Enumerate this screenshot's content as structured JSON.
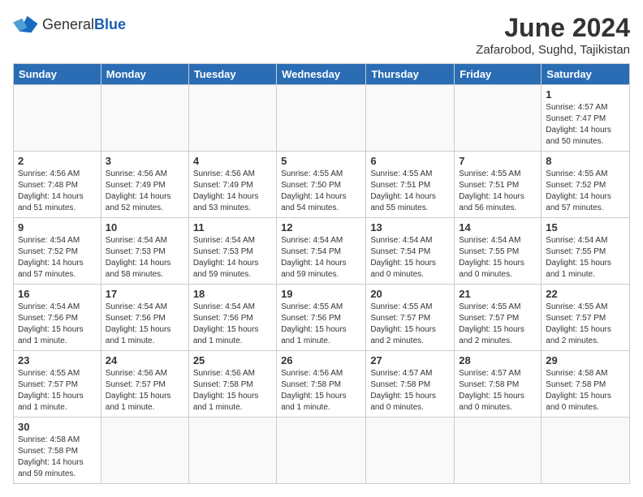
{
  "header": {
    "logo_general": "General",
    "logo_blue": "Blue",
    "title": "June 2024",
    "subtitle": "Zafarobod, Sughd, Tajikistan"
  },
  "days_of_week": [
    "Sunday",
    "Monday",
    "Tuesday",
    "Wednesday",
    "Thursday",
    "Friday",
    "Saturday"
  ],
  "weeks": [
    [
      {
        "day": "",
        "info": ""
      },
      {
        "day": "",
        "info": ""
      },
      {
        "day": "",
        "info": ""
      },
      {
        "day": "",
        "info": ""
      },
      {
        "day": "",
        "info": ""
      },
      {
        "day": "",
        "info": ""
      },
      {
        "day": "1",
        "info": "Sunrise: 4:57 AM\nSunset: 7:47 PM\nDaylight: 14 hours and 50 minutes."
      }
    ],
    [
      {
        "day": "2",
        "info": "Sunrise: 4:56 AM\nSunset: 7:48 PM\nDaylight: 14 hours and 51 minutes."
      },
      {
        "day": "3",
        "info": "Sunrise: 4:56 AM\nSunset: 7:49 PM\nDaylight: 14 hours and 52 minutes."
      },
      {
        "day": "4",
        "info": "Sunrise: 4:56 AM\nSunset: 7:49 PM\nDaylight: 14 hours and 53 minutes."
      },
      {
        "day": "5",
        "info": "Sunrise: 4:55 AM\nSunset: 7:50 PM\nDaylight: 14 hours and 54 minutes."
      },
      {
        "day": "6",
        "info": "Sunrise: 4:55 AM\nSunset: 7:51 PM\nDaylight: 14 hours and 55 minutes."
      },
      {
        "day": "7",
        "info": "Sunrise: 4:55 AM\nSunset: 7:51 PM\nDaylight: 14 hours and 56 minutes."
      },
      {
        "day": "8",
        "info": "Sunrise: 4:55 AM\nSunset: 7:52 PM\nDaylight: 14 hours and 57 minutes."
      }
    ],
    [
      {
        "day": "9",
        "info": "Sunrise: 4:54 AM\nSunset: 7:52 PM\nDaylight: 14 hours and 57 minutes."
      },
      {
        "day": "10",
        "info": "Sunrise: 4:54 AM\nSunset: 7:53 PM\nDaylight: 14 hours and 58 minutes."
      },
      {
        "day": "11",
        "info": "Sunrise: 4:54 AM\nSunset: 7:53 PM\nDaylight: 14 hours and 59 minutes."
      },
      {
        "day": "12",
        "info": "Sunrise: 4:54 AM\nSunset: 7:54 PM\nDaylight: 14 hours and 59 minutes."
      },
      {
        "day": "13",
        "info": "Sunrise: 4:54 AM\nSunset: 7:54 PM\nDaylight: 15 hours and 0 minutes."
      },
      {
        "day": "14",
        "info": "Sunrise: 4:54 AM\nSunset: 7:55 PM\nDaylight: 15 hours and 0 minutes."
      },
      {
        "day": "15",
        "info": "Sunrise: 4:54 AM\nSunset: 7:55 PM\nDaylight: 15 hours and 1 minute."
      }
    ],
    [
      {
        "day": "16",
        "info": "Sunrise: 4:54 AM\nSunset: 7:56 PM\nDaylight: 15 hours and 1 minute."
      },
      {
        "day": "17",
        "info": "Sunrise: 4:54 AM\nSunset: 7:56 PM\nDaylight: 15 hours and 1 minute."
      },
      {
        "day": "18",
        "info": "Sunrise: 4:54 AM\nSunset: 7:56 PM\nDaylight: 15 hours and 1 minute."
      },
      {
        "day": "19",
        "info": "Sunrise: 4:55 AM\nSunset: 7:56 PM\nDaylight: 15 hours and 1 minute."
      },
      {
        "day": "20",
        "info": "Sunrise: 4:55 AM\nSunset: 7:57 PM\nDaylight: 15 hours and 2 minutes."
      },
      {
        "day": "21",
        "info": "Sunrise: 4:55 AM\nSunset: 7:57 PM\nDaylight: 15 hours and 2 minutes."
      },
      {
        "day": "22",
        "info": "Sunrise: 4:55 AM\nSunset: 7:57 PM\nDaylight: 15 hours and 2 minutes."
      }
    ],
    [
      {
        "day": "23",
        "info": "Sunrise: 4:55 AM\nSunset: 7:57 PM\nDaylight: 15 hours and 1 minute."
      },
      {
        "day": "24",
        "info": "Sunrise: 4:56 AM\nSunset: 7:57 PM\nDaylight: 15 hours and 1 minute."
      },
      {
        "day": "25",
        "info": "Sunrise: 4:56 AM\nSunset: 7:58 PM\nDaylight: 15 hours and 1 minute."
      },
      {
        "day": "26",
        "info": "Sunrise: 4:56 AM\nSunset: 7:58 PM\nDaylight: 15 hours and 1 minute."
      },
      {
        "day": "27",
        "info": "Sunrise: 4:57 AM\nSunset: 7:58 PM\nDaylight: 15 hours and 0 minutes."
      },
      {
        "day": "28",
        "info": "Sunrise: 4:57 AM\nSunset: 7:58 PM\nDaylight: 15 hours and 0 minutes."
      },
      {
        "day": "29",
        "info": "Sunrise: 4:58 AM\nSunset: 7:58 PM\nDaylight: 15 hours and 0 minutes."
      }
    ],
    [
      {
        "day": "30",
        "info": "Sunrise: 4:58 AM\nSunset: 7:58 PM\nDaylight: 14 hours and 59 minutes."
      },
      {
        "day": "",
        "info": ""
      },
      {
        "day": "",
        "info": ""
      },
      {
        "day": "",
        "info": ""
      },
      {
        "day": "",
        "info": ""
      },
      {
        "day": "",
        "info": ""
      },
      {
        "day": "",
        "info": ""
      }
    ]
  ]
}
